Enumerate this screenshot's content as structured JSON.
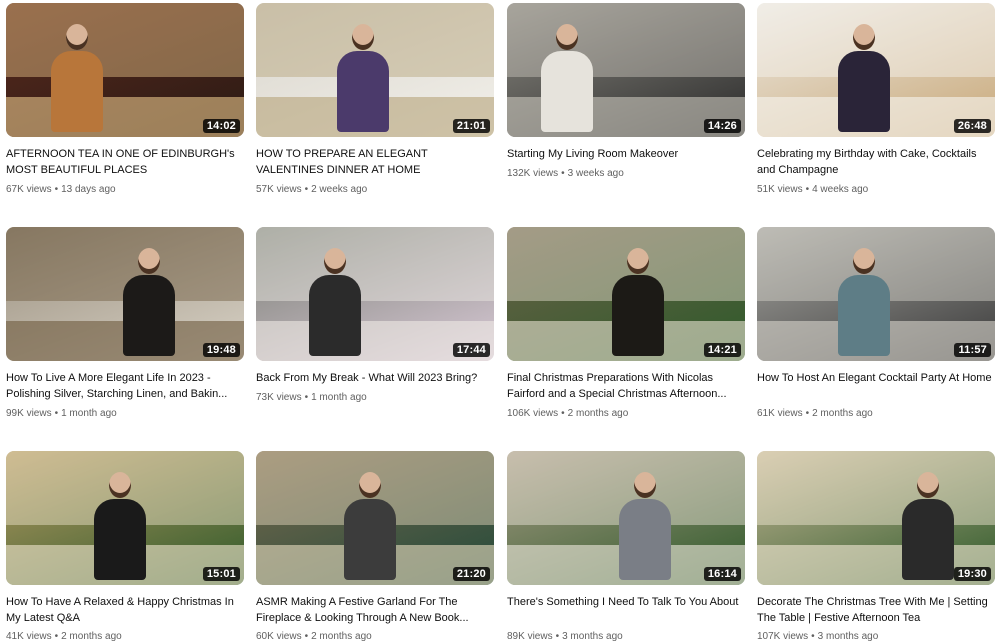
{
  "videos": [
    {
      "title": "AFTERNOON TEA IN ONE OF EDINBURGH's MOST BEAUTIFUL PLACES",
      "duration": "14:02",
      "views": "67K views",
      "age": "13 days ago",
      "colors": [
        "#5a2a1e",
        "#b8763a",
        "#2a1a14",
        "#e8c58a"
      ]
    },
    {
      "title": "HOW TO PREPARE AN ELEGANT VALENTINES DINNER AT HOME",
      "duration": "21:01",
      "views": "57K views",
      "age": "2 weeks ago",
      "colors": [
        "#d9d5cc",
        "#4b3a6b",
        "#f2f0ea",
        "#b5a37a"
      ]
    },
    {
      "title": "Starting My Living Room Makeover",
      "duration": "14:26",
      "views": "132K views",
      "age": "3 weeks ago",
      "colors": [
        "#8c8a82",
        "#e6e3dc",
        "#2a2a2a",
        "#c9c6bd"
      ]
    },
    {
      "title": "Celebrating my Birthday with Cake, Cocktails and Champagne",
      "duration": "26:48",
      "views": "51K views",
      "age": "4 weeks ago",
      "colors": [
        "#ece8e0",
        "#2a2438",
        "#c9a97a",
        "#f7f5f0"
      ]
    },
    {
      "title": "How To Live A More Elegant Life In 2023 - Polishing Silver, Starching Linen, and Bakin...",
      "duration": "19:48",
      "views": "99K views",
      "age": "1 month ago",
      "colors": [
        "#9a8f7e",
        "#1c1a18",
        "#d8d2c6",
        "#6e5a3e"
      ]
    },
    {
      "title": "Back From My Break - What Will 2023 Bring?",
      "duration": "17:44",
      "views": "73K views",
      "age": "1 month ago",
      "colors": [
        "#7a7e74",
        "#2b2b2b",
        "#d8c9d6",
        "#eeeae4"
      ]
    },
    {
      "title": "Final Christmas Preparations With Nicolas Fairford and a Special Christmas Afternoon...",
      "duration": "14:21",
      "views": "106K views",
      "age": "2 months ago",
      "colors": [
        "#6c6248",
        "#1c1a16",
        "#2d5a2a",
        "#e9e2d2"
      ]
    },
    {
      "title": "How To Host An Elegant Cocktail Party At Home",
      "duration": "11:57",
      "views": "61K views",
      "age": "2 months ago",
      "colors": [
        "#a9a8a3",
        "#5e7d86",
        "#3a3a3a",
        "#d7d4cc"
      ]
    },
    {
      "title": "How To Have A Relaxed & Happy Christmas In My Latest Q&A",
      "duration": "15:01",
      "views": "41K views",
      "age": "2 months ago",
      "colors": [
        "#b59a62",
        "#1a1a1a",
        "#2f5a2a",
        "#f0e6cf"
      ]
    },
    {
      "title": "ASMR Making A Festive Garland For The Fireplace & Looking Through A New Book...",
      "duration": "21:20",
      "views": "60K views",
      "age": "2 months ago",
      "colors": [
        "#7a6a4e",
        "#3c3c3c",
        "#234a3a",
        "#e8dcc0"
      ]
    },
    {
      "title": "There's Something I Need To Talk To You About",
      "duration": "16:14",
      "views": "89K views",
      "age": "3 months ago",
      "colors": [
        "#a79b85",
        "#7a7e86",
        "#2f5a2a",
        "#efe9de"
      ]
    },
    {
      "title": "Decorate The Christmas Tree With Me | Setting The Table | Festive Afternoon Tea",
      "duration": "19:30",
      "views": "107K views",
      "age": "3 months ago",
      "colors": [
        "#c5b796",
        "#2a2a2a",
        "#2f5a2a",
        "#f3ead6"
      ]
    }
  ]
}
